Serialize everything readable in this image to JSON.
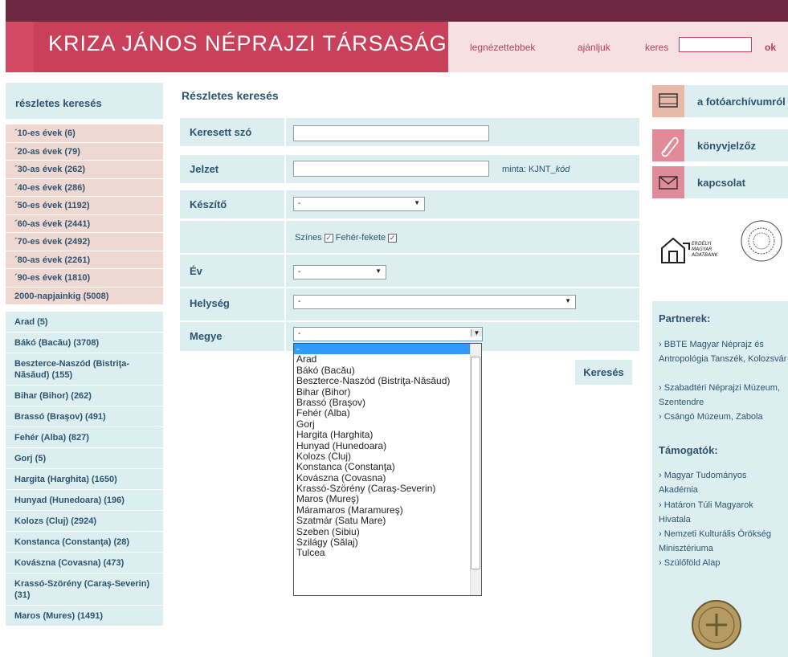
{
  "header": {
    "title": "KRIZA JÁNOS NÉPRAJZI TÁRSASÁG KÉPTÁRA",
    "nav": [
      "legnézettebbek",
      "ajánljuk",
      "keres"
    ],
    "ok_label": "ok"
  },
  "sidebar": {
    "heading": "részletes keresés",
    "decades": [
      "´10-es évek (6)",
      "´20-as évek (79)",
      "´30-as évek (262)",
      "´40-es évek (286)",
      "´50-es évek (1192)",
      "´60-as évek (2441)",
      "´70-es évek (2492)",
      "´80-as évek (2261)",
      "´90-es évek (1810)",
      "2000-napjainkig (5008)"
    ],
    "counties": [
      "Arad (5)",
      "Bákó (Bacău) (3708)",
      "Beszterce-Naszód (Bistriţa-Năsăud) (155)",
      "Bihar (Bihor) (262)",
      "Brassó (Braşov) (491)",
      "Fehér (Alba) (827)",
      "Gorj (5)",
      "Hargita (Harghita) (1650)",
      "Hunyad (Hunedoara) (196)",
      "Kolozs (Cluj) (2924)",
      "Konstanca (Constanţa) (28)",
      "Kovászna (Covasna) (473)",
      "Krassó-Szörény (Caraş-Severin) (31)",
      "Maros (Mures) (1491)"
    ]
  },
  "main": {
    "title": "Részletes keresés",
    "labels": {
      "keresett_szo": "Keresett szó",
      "jelzet": "Jelzet",
      "keszito": "Készítő",
      "ev": "Év",
      "helyseg": "Helység",
      "megye": "Megye"
    },
    "minta_prefix": "minta: KJNT_",
    "minta_italic": "kód",
    "select_default": "-",
    "szines": "Színes",
    "feher_fekete": "Fehér-fekete",
    "search_button": "Keresés"
  },
  "dropdown_options": [
    "-",
    "Arad",
    "Bákó (Bacău)",
    "Beszterce-Naszód (Bistriţa-Năsăud)",
    "Bihar (Bihor)",
    "Brassó (Braşov)",
    "Fehér (Alba)",
    "Gorj",
    "Hargita (Harghita)",
    "Hunyad (Hunedoara)",
    "Kolozs (Cluj)",
    "Konstanca (Constanţa)",
    "Kovászna (Covasna)",
    "Krassó-Szörény (Caraş-Severin)",
    "Maros (Mureş)",
    "Máramaros (Maramureş)",
    "Szatmár (Satu Mare)",
    "Szeben (Sibiu)",
    "Szilágy (Sălaj)",
    "Tulcea"
  ],
  "right": {
    "buttons": [
      "a fotóarchívumról",
      "könyvjelzőz",
      "kapcsolat"
    ],
    "logo_text": "ERDÉLYI MAGYAR ADATBANK",
    "seal_text": "KRIZA JÁNOS NÉPRAJZI TÁRSASÁG",
    "coin_text": "SZÜLŐFÖLD ALAP",
    "partners_heading": "Partnerek:",
    "partners": [
      "› BBTE Magyar Néprajz és Antropológia Tanszék, Kolozsvár",
      "› Szabadtéri Néprajzi Múzeum, Szentendre",
      "› Csángó Múzeum, Zabola"
    ],
    "supporters_heading": "Támogatók:",
    "supporters": [
      "› Magyar Tudományos Akadémia",
      "› Határon Túli Magyarok Hivatala",
      "› Nemzeti Kulturális Örökség Minisztériuma",
      "› Szülőföld Alap"
    ]
  }
}
